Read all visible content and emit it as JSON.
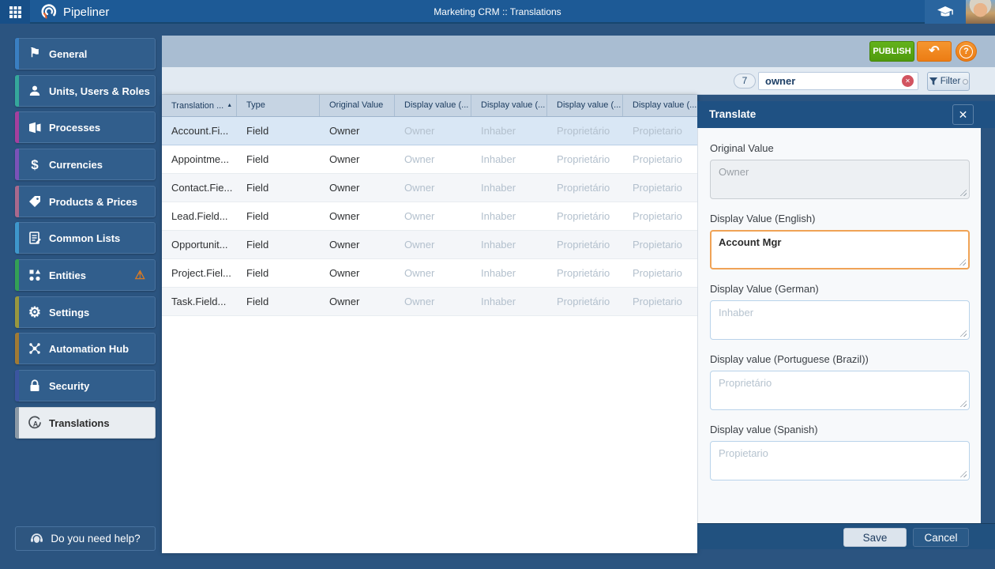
{
  "topbar": {
    "brand": "Pipeliner",
    "title": "Marketing CRM :: Translations"
  },
  "icons": {
    "sort_asc": "▲",
    "undo": "↶",
    "question": "?",
    "close": "✕",
    "clear": "✕",
    "warning": "⚠",
    "dollar": "$",
    "gear": "⚙",
    "flag": "⚑",
    "globe_letter": "A"
  },
  "sidebar": {
    "items": [
      {
        "label": "General",
        "accent": "#3a7fc2"
      },
      {
        "label": "Units, Users & Roles",
        "accent": "#35a79b"
      },
      {
        "label": "Processes",
        "accent": "#a43f9e"
      },
      {
        "label": "Currencies",
        "accent": "#7b52b8"
      },
      {
        "label": "Products & Prices",
        "accent": "#a8698d"
      },
      {
        "label": "Common Lists",
        "accent": "#3e97cc"
      },
      {
        "label": "Entities",
        "accent": "#33a055",
        "warning": true
      },
      {
        "label": "Settings",
        "accent": "#98973f"
      },
      {
        "label": "Automation Hub",
        "accent": "#a07a35"
      },
      {
        "label": "Security",
        "accent": "#3b55a0"
      },
      {
        "label": "Translations",
        "accent": "#8b99a6",
        "selected": true
      }
    ],
    "help_label": "Do you need help?"
  },
  "toolbar": {
    "publish_label": "PUBLISH",
    "result_count": "7",
    "search_value": "owner",
    "filter_label": "Filter"
  },
  "table": {
    "columns": [
      "Translation ...",
      "Type",
      "Original Value",
      "Display value (...",
      "Display value (...",
      "Display value (...",
      "Display value (..."
    ],
    "rows": [
      {
        "cells": [
          "Account.Fi...",
          "Field",
          "Owner",
          "Owner",
          "Inhaber",
          "Proprietário",
          "Propietario"
        ]
      },
      {
        "cells": [
          "Appointme...",
          "Field",
          "Owner",
          "Owner",
          "Inhaber",
          "Proprietário",
          "Propietario"
        ]
      },
      {
        "cells": [
          "Contact.Fie...",
          "Field",
          "Owner",
          "Owner",
          "Inhaber",
          "Proprietário",
          "Propietario"
        ]
      },
      {
        "cells": [
          "Lead.Field...",
          "Field",
          "Owner",
          "Owner",
          "Inhaber",
          "Proprietário",
          "Propietario"
        ]
      },
      {
        "cells": [
          "Opportunit...",
          "Field",
          "Owner",
          "Owner",
          "Inhaber",
          "Proprietário",
          "Propietario"
        ]
      },
      {
        "cells": [
          "Project.Fiel...",
          "Field",
          "Owner",
          "Owner",
          "Inhaber",
          "Proprietário",
          "Propietario"
        ]
      },
      {
        "cells": [
          "Task.Field...",
          "Field",
          "Owner",
          "Owner",
          "Inhaber",
          "Proprietário",
          "Propietario"
        ]
      }
    ]
  },
  "panel": {
    "title": "Translate",
    "fields": [
      {
        "label": "Original Value",
        "value": "Owner",
        "state": "disabled"
      },
      {
        "label": "Display Value (English)",
        "value": "Account Mgr",
        "state": "focused"
      },
      {
        "label": "Display Value (German)",
        "placeholder": "Inhaber",
        "state": "empty"
      },
      {
        "label": "Display value (Portuguese (Brazil))",
        "placeholder": "Proprietário",
        "state": "empty"
      },
      {
        "label": "Display value (Spanish)",
        "placeholder": "Propietario",
        "state": "empty"
      }
    ],
    "save_label": "Save",
    "cancel_label": "Cancel"
  },
  "colors": {
    "page_bg": "#2b5480",
    "topbar": "#1d5a96",
    "publish_green": "#55a514",
    "accent_orange": "#f08223",
    "panel_header": "#1f5183",
    "selected_row": "#d9e7f5"
  }
}
